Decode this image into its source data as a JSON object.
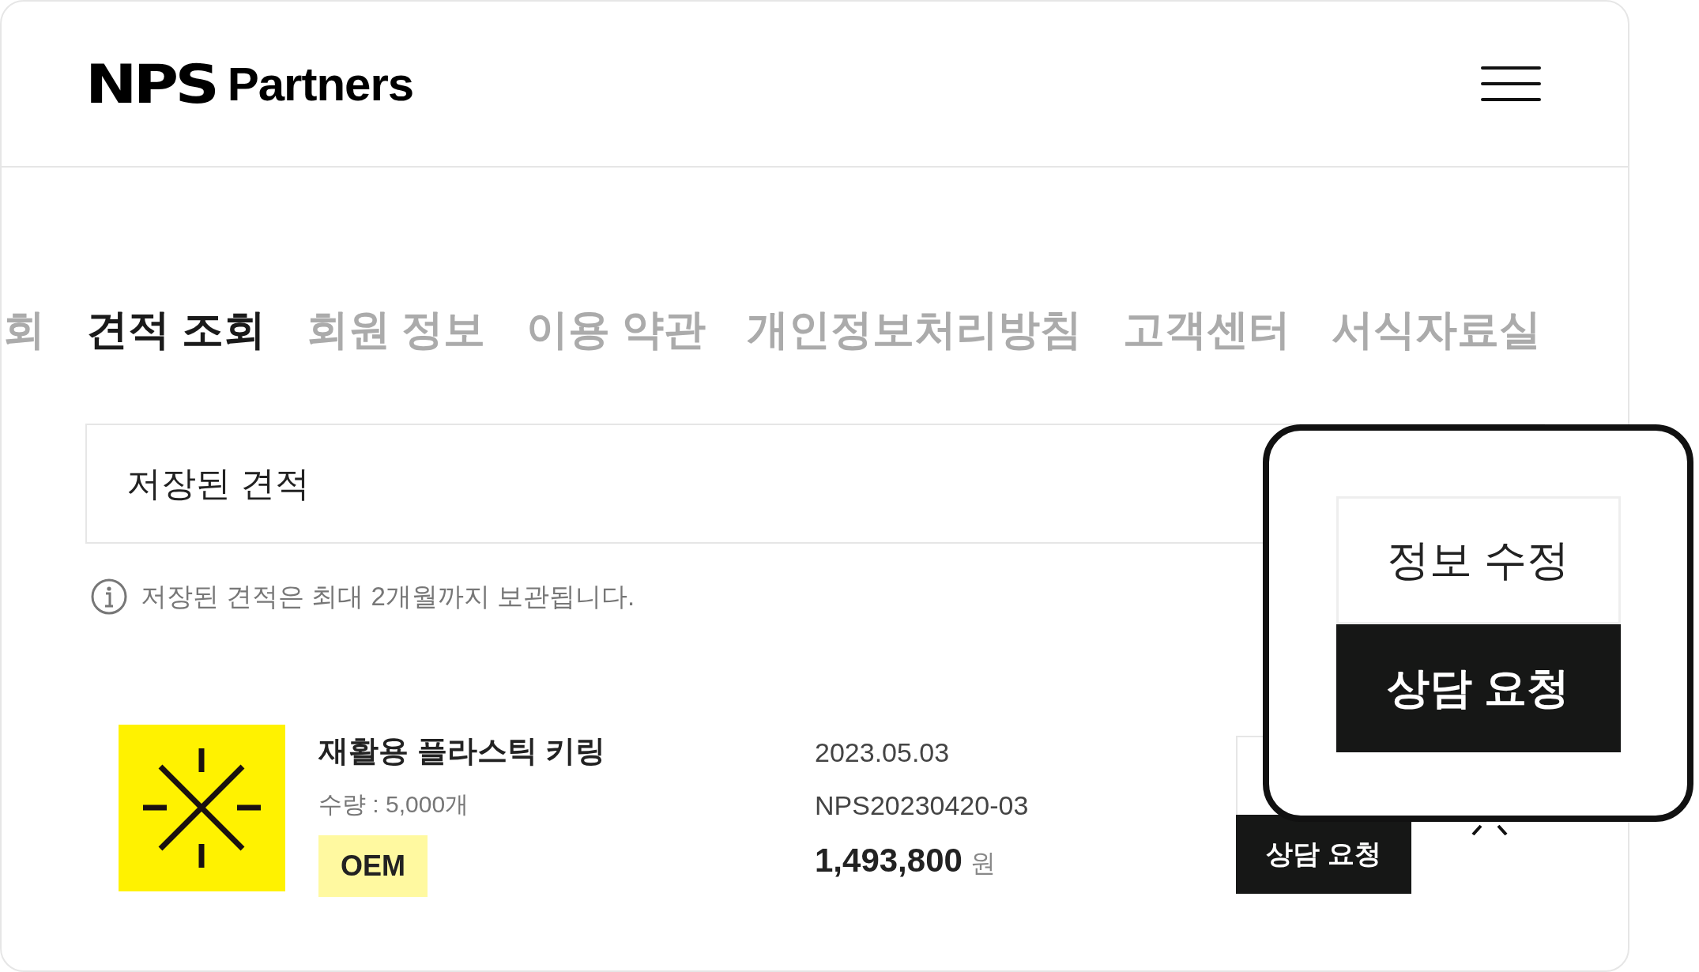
{
  "header": {
    "logo": {
      "mark": "NPS",
      "wordmark": "Partners"
    }
  },
  "tabs": [
    {
      "label": "회",
      "selected": false
    },
    {
      "label": "견적 조회",
      "selected": true
    },
    {
      "label": "회원 정보",
      "selected": false
    },
    {
      "label": "이용 약관",
      "selected": false
    },
    {
      "label": "개인정보처리방침",
      "selected": false
    },
    {
      "label": "고객센터",
      "selected": false
    },
    {
      "label": "서식자료실",
      "selected": false
    }
  ],
  "saved_quotes": {
    "title": "저장된 견적",
    "notice": "저장된 견적은 최대 2개월까지 보관됩니다."
  },
  "quotes": [
    {
      "name": "재활용 플라스틱 키링",
      "quantity": "수량 : 5,000개",
      "tag": "OEM",
      "date": "2023.05.03",
      "quote_number": "NPS20230420-03",
      "price": "1,493,800",
      "currency": "원",
      "button": "상담 요청"
    }
  ],
  "popup": {
    "buttons": [
      {
        "label": "정보 수정",
        "kind": "outline"
      },
      {
        "label": "상담 요청",
        "kind": "filled"
      }
    ]
  }
}
